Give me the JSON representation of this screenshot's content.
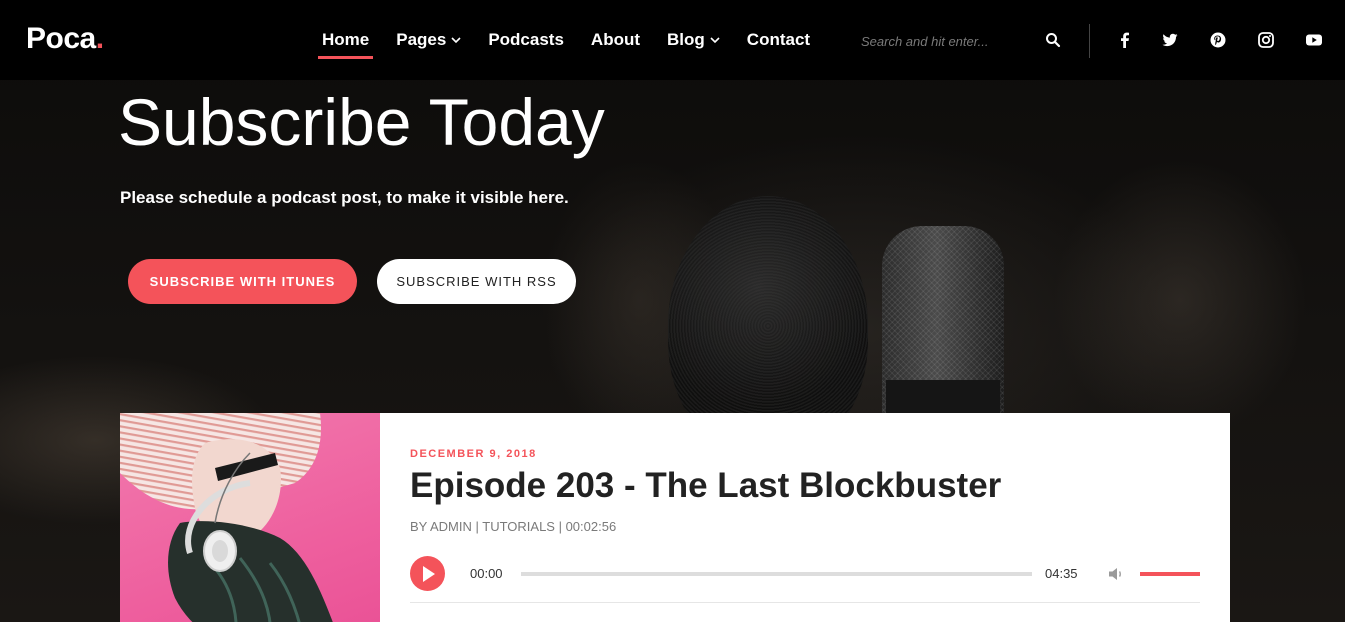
{
  "brand": {
    "name": "Poca",
    "dot": ".",
    "accent_color": "#f4535a"
  },
  "nav": {
    "items": [
      {
        "label": "Home",
        "active": true,
        "dropdown": false
      },
      {
        "label": "Pages",
        "active": false,
        "dropdown": true
      },
      {
        "label": "Podcasts",
        "active": false,
        "dropdown": false
      },
      {
        "label": "About",
        "active": false,
        "dropdown": false
      },
      {
        "label": "Blog",
        "active": false,
        "dropdown": true
      },
      {
        "label": "Contact",
        "active": false,
        "dropdown": false
      }
    ]
  },
  "search": {
    "placeholder": "Search and hit enter...",
    "icon": "search-icon"
  },
  "social": [
    "facebook-icon",
    "twitter-icon",
    "pinterest-icon",
    "instagram-icon",
    "youtube-icon"
  ],
  "hero": {
    "title": "Subscribe Today",
    "subtitle": "Please schedule a podcast post, to make it visible here.",
    "btn_itunes": "SUBSCRIBE WITH ITUNES",
    "btn_rss": "SUBSCRIBE WITH RSS"
  },
  "episode": {
    "date": "DECEMBER 9, 2018",
    "title": "Episode 203 - The Last Blockbuster",
    "meta": "BY ADMIN | TUTORIALS | 00:02:56",
    "player": {
      "current_time": "00:00",
      "duration": "04:35",
      "progress": 0,
      "volume": 1
    }
  }
}
